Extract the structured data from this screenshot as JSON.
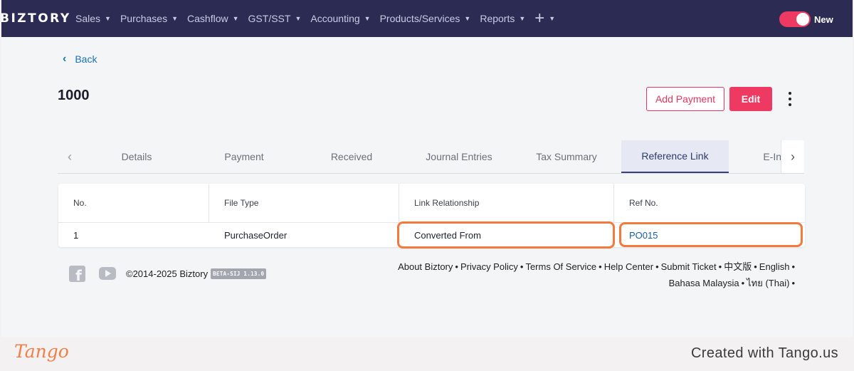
{
  "nav": {
    "brand": "BIZTORY",
    "menu": [
      {
        "label": "Sales"
      },
      {
        "label": "Purchases"
      },
      {
        "label": "Cashflow"
      },
      {
        "label": "GST/SST"
      },
      {
        "label": "Accounting"
      },
      {
        "label": "Products/Services"
      },
      {
        "label": "Reports"
      }
    ],
    "plus": "+",
    "toggle_label": "New",
    "toggle_on": true
  },
  "page": {
    "back_label": "Back",
    "title": "1000",
    "add_payment_label": "Add Payment",
    "edit_label": "Edit"
  },
  "tabs": [
    {
      "label": "Details",
      "active": false
    },
    {
      "label": "Payment",
      "active": false
    },
    {
      "label": "Received",
      "active": false
    },
    {
      "label": "Journal Entries",
      "active": false
    },
    {
      "label": "Tax Summary",
      "active": false
    },
    {
      "label": "Reference Link",
      "active": true
    },
    {
      "label": "E-Inv",
      "active": false
    }
  ],
  "table": {
    "headers": [
      "No.",
      "File Type",
      "Link Relationship",
      "Ref No."
    ],
    "rows": [
      {
        "no": "1",
        "file_type": "PurchaseOrder",
        "relationship": "Converted From",
        "ref_no": "PO015"
      }
    ]
  },
  "footer": {
    "copyright": "©2014-2025 Biztory",
    "version": "BETA-SIJ 1.13.0",
    "links_line1": [
      "About Biztory",
      "Privacy Policy",
      "Terms Of Service",
      "Help Center",
      "Submit Ticket",
      "中文版",
      "English"
    ],
    "links_line2": [
      "Bahasa Malaysia",
      "ไทย (Thai)"
    ],
    "separator": "•"
  },
  "tango": {
    "logo": "Tango",
    "credit": "Created with Tango.us"
  },
  "colors": {
    "nav_bg": "#2c2b54",
    "accent": "#ee3a62",
    "highlight": "#f27a3f",
    "link": "#1a5ea8"
  }
}
